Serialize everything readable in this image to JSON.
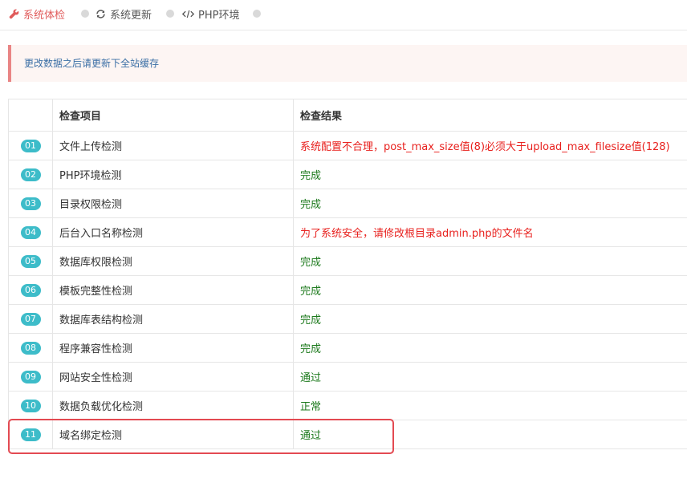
{
  "tabs": [
    {
      "label": "系统体检",
      "icon": "wrench-icon",
      "active": true,
      "color": "#e05b5b"
    },
    {
      "label": "系统更新",
      "icon": "refresh-icon",
      "active": false
    },
    {
      "label": "PHP环境",
      "icon": "code-icon",
      "active": false
    }
  ],
  "alert": {
    "text": "更改数据之后请更新下全站缓存"
  },
  "table": {
    "columns": [
      "",
      "检查项目",
      "检查结果"
    ],
    "rows": [
      {
        "num": "01",
        "item": "文件上传检测",
        "result": "系统配置不合理，post_max_size值(8)必须大于upload_max_filesize值(128)",
        "status": "error"
      },
      {
        "num": "02",
        "item": "PHP环境检测",
        "result": "完成",
        "status": "ok"
      },
      {
        "num": "03",
        "item": "目录权限检测",
        "result": "完成",
        "status": "ok"
      },
      {
        "num": "04",
        "item": "后台入口名称检测",
        "result": "为了系统安全，请修改根目录admin.php的文件名",
        "status": "error"
      },
      {
        "num": "05",
        "item": "数据库权限检测",
        "result": "完成",
        "status": "ok"
      },
      {
        "num": "06",
        "item": "模板完整性检测",
        "result": "完成",
        "status": "ok"
      },
      {
        "num": "07",
        "item": "数据库表结构检测",
        "result": "完成",
        "status": "ok"
      },
      {
        "num": "08",
        "item": "程序兼容性检测",
        "result": "完成",
        "status": "ok"
      },
      {
        "num": "09",
        "item": "网站安全性检测",
        "result": "通过",
        "status": "ok"
      },
      {
        "num": "10",
        "item": "数据负载优化检测",
        "result": "正常",
        "status": "ok"
      },
      {
        "num": "11",
        "item": "域名绑定检测",
        "result": "通过",
        "status": "ok"
      }
    ]
  },
  "colors": {
    "badge": "#3dbcc9",
    "error_text": "#e8211e",
    "ok_text": "#1d7a1d",
    "highlight_border": "#e34a52"
  }
}
